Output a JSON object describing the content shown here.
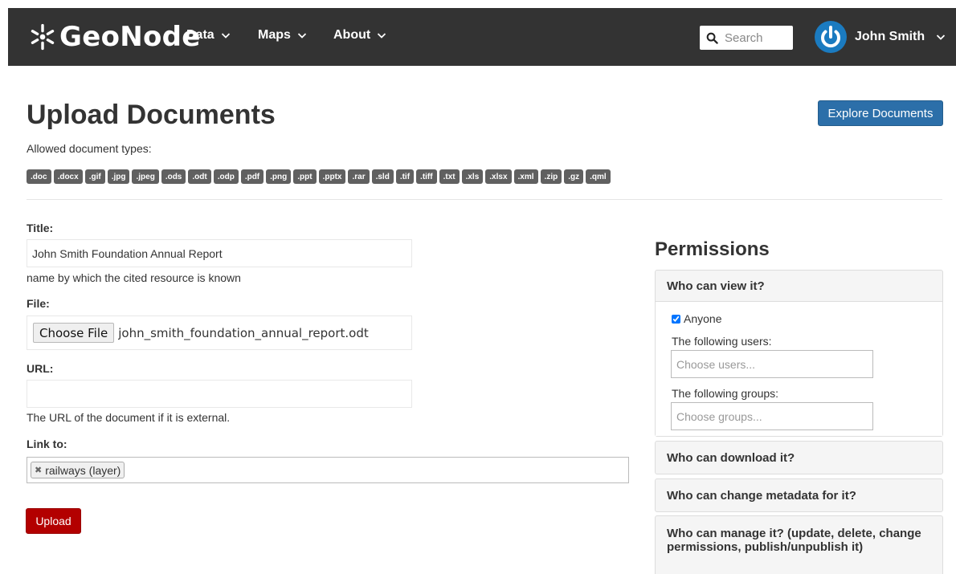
{
  "navbar": {
    "brand": "GeoNode",
    "menu": [
      {
        "label": "Data"
      },
      {
        "label": "Maps"
      },
      {
        "label": "About"
      }
    ],
    "search_placeholder": "Search",
    "user_name": "John Smith"
  },
  "header": {
    "title": "Upload Documents",
    "explore_button": "Explore Documents",
    "allowed_label": "Allowed document types:",
    "types": [
      ".doc",
      ".docx",
      ".gif",
      ".jpg",
      ".jpeg",
      ".ods",
      ".odt",
      ".odp",
      ".pdf",
      ".png",
      ".ppt",
      ".pptx",
      ".rar",
      ".sld",
      ".tif",
      ".tiff",
      ".txt",
      ".xls",
      ".xlsx",
      ".xml",
      ".zip",
      ".gz",
      ".qml"
    ]
  },
  "form": {
    "title_label": "Title:",
    "title_value": "John Smith Foundation Annual Report",
    "title_help": "name by which the cited resource is known",
    "file_label": "File:",
    "choose_file": "Choose File",
    "file_name": "john_smith_foundation_annual_report.odt",
    "url_label": "URL:",
    "url_value": "",
    "url_help": "The URL of the document if it is external.",
    "link_label": "Link to:",
    "link_tag": "railways (layer)",
    "upload_button": "Upload"
  },
  "permissions": {
    "title": "Permissions",
    "view": {
      "header": "Who can view it?",
      "anyone_label": "Anyone",
      "anyone_checked": true,
      "users_label": "The following users:",
      "users_placeholder": "Choose users...",
      "groups_label": "The following groups:",
      "groups_placeholder": "Choose groups..."
    },
    "download_header": "Who can download it?",
    "metadata_header": "Who can change metadata for it?",
    "manage_header": "Who can manage it? (update, delete, change permissions, publish/unpublish it)"
  },
  "colors": {
    "navbar_bg": "#333333",
    "primary": "#2c6fa9",
    "danger": "#b30000",
    "avatar": "#1b7bc0"
  }
}
